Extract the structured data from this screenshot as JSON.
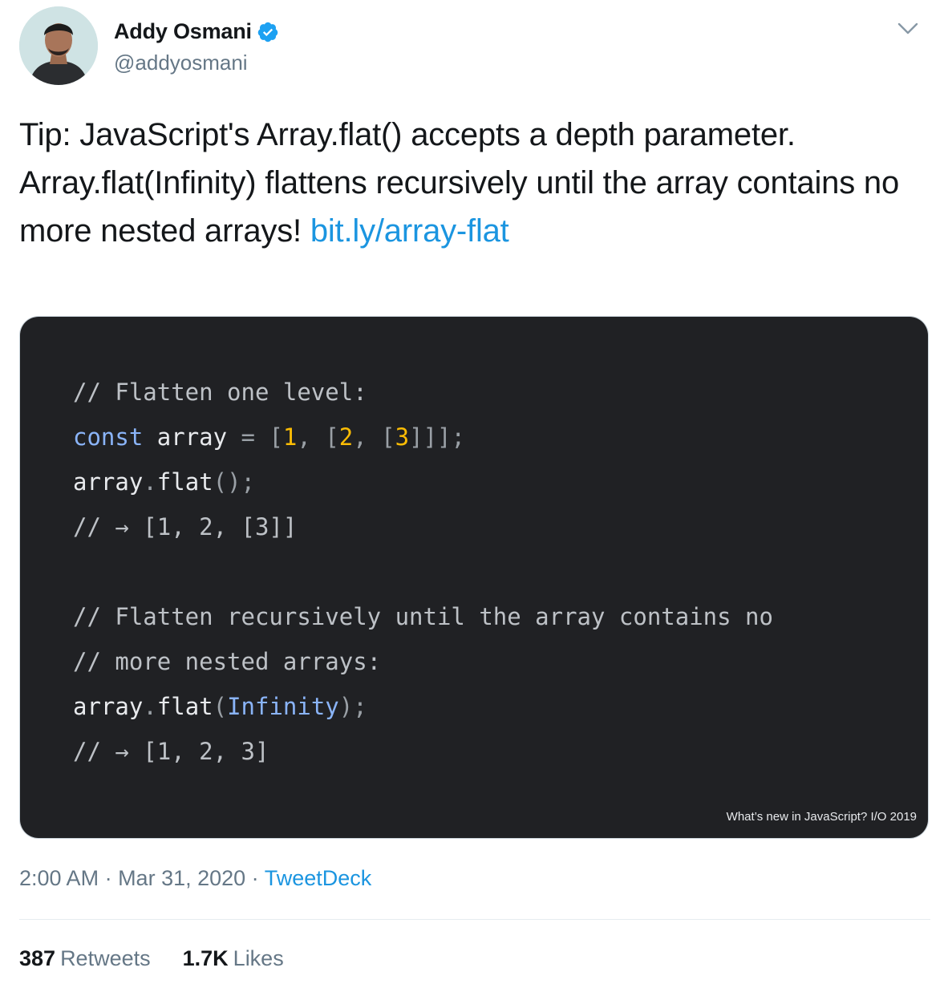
{
  "author": {
    "name": "Addy Osmani",
    "handle": "@addyosmani"
  },
  "tweet": {
    "text": "Tip: JavaScript's Array.flat() accepts a depth parameter. Array.flat(Infinity) flattens recursively until the array contains no more nested arrays! ",
    "link_text": "bit.ly/array-flat"
  },
  "media": {
    "code_lines": [
      [
        {
          "t": "// Flatten one level:",
          "c": "c-com"
        }
      ],
      [
        {
          "t": "const",
          "c": "c-kw"
        },
        {
          "t": " array ",
          "c": ""
        },
        {
          "t": "=",
          "c": "c-punc"
        },
        {
          "t": " [",
          "c": "c-punc"
        },
        {
          "t": "1",
          "c": "c-num"
        },
        {
          "t": ", [",
          "c": "c-punc"
        },
        {
          "t": "2",
          "c": "c-num"
        },
        {
          "t": ", [",
          "c": "c-punc"
        },
        {
          "t": "3",
          "c": "c-num"
        },
        {
          "t": "]]];",
          "c": "c-punc"
        }
      ],
      [
        {
          "t": "array",
          "c": ""
        },
        {
          "t": ".",
          "c": "c-punc"
        },
        {
          "t": "flat",
          "c": ""
        },
        {
          "t": "();",
          "c": "c-punc"
        }
      ],
      [
        {
          "t": "// → [1, 2, [3]]",
          "c": "c-com"
        }
      ],
      [
        {
          "t": "",
          "c": ""
        }
      ],
      [
        {
          "t": "// Flatten recursively until the array contains no",
          "c": "c-com"
        }
      ],
      [
        {
          "t": "// more nested arrays:",
          "c": "c-com"
        }
      ],
      [
        {
          "t": "array",
          "c": ""
        },
        {
          "t": ".",
          "c": "c-punc"
        },
        {
          "t": "flat",
          "c": ""
        },
        {
          "t": "(",
          "c": "c-punc"
        },
        {
          "t": "Infinity",
          "c": "c-kw"
        },
        {
          "t": ");",
          "c": "c-punc"
        }
      ],
      [
        {
          "t": "// → [1, 2, 3]",
          "c": "c-com"
        }
      ]
    ],
    "caption": "What’s new in JavaScript? I/O 2019"
  },
  "meta": {
    "time": "2:00 AM",
    "sep1": " · ",
    "date": "Mar 31, 2020",
    "sep2": " · ",
    "source": "TweetDeck"
  },
  "stats": {
    "retweets_count": "387",
    "retweets_label": "Retweets",
    "likes_count": "1.7K",
    "likes_label": "Likes"
  }
}
